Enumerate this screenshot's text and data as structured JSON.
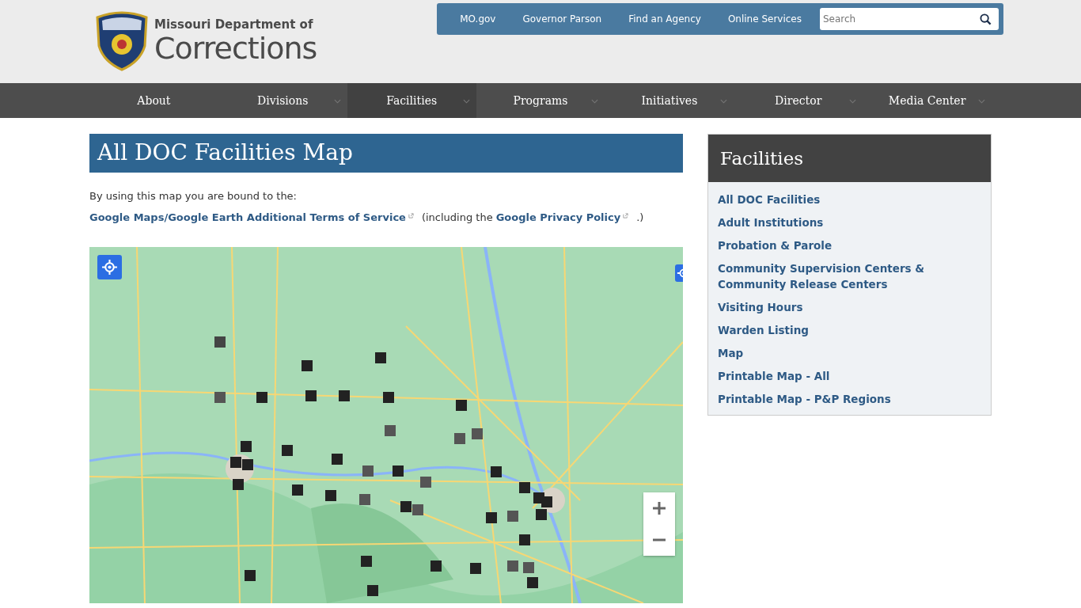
{
  "logo": {
    "line_1": "Missouri Department of",
    "line_2": "Corrections"
  },
  "top_links": [
    "MO.gov",
    "Governor Parson",
    "Find an Agency",
    "Online Services"
  ],
  "search": {
    "placeholder": "Search"
  },
  "nav": [
    {
      "label": "About",
      "has_menu": false,
      "selected": false
    },
    {
      "label": "Divisions",
      "has_menu": true,
      "selected": false
    },
    {
      "label": "Facilities",
      "has_menu": true,
      "selected": true
    },
    {
      "label": "Programs",
      "has_menu": true,
      "selected": false
    },
    {
      "label": "Initiatives",
      "has_menu": true,
      "selected": false
    },
    {
      "label": "Director",
      "has_menu": true,
      "selected": false
    },
    {
      "label": "Media Center",
      "has_menu": true,
      "selected": false
    }
  ],
  "page_title": "All DOC Facilities Map",
  "intro": "By using this map you are bound to the:",
  "terms": {
    "link_1": "Google Maps/Google Earth Additional Terms of Service",
    "middle": "(including the",
    "link_2": "Google Privacy Policy",
    "end": ".)"
  },
  "sidebar": {
    "title": "Facilities",
    "items": [
      "All DOC Facilities",
      "Adult Institutions",
      "Probation & Parole",
      "Community Supervision Centers & Community Release Centers",
      "Visiting Hours",
      "Warden Listing",
      "Map",
      "Printable Map - All",
      "Printable Map - P&P Regions"
    ]
  }
}
